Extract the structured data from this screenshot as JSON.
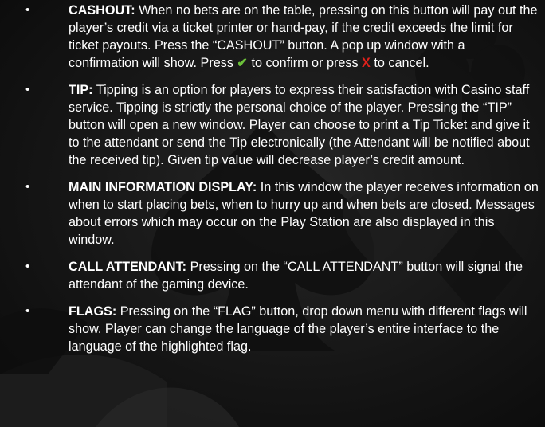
{
  "items": [
    {
      "term": "CASHOUT:",
      "text_before": " When no bets are on the table, pressing on this button will pay out the player’s credit via a ticket printer or hand-pay, if the credit exceeds the limit for ticket payouts. Press the “CASHOUT” button. A pop up window with a confirmation will show. Press ",
      "confirm_symbol": "✔",
      "confirm_icon": "green-check-icon",
      "text_middle": " to confirm or press ",
      "cancel_symbol": "X",
      "cancel_icon": "red-x-icon",
      "text_after": " to cancel."
    },
    {
      "term": "TIP:",
      "text": " Tipping is an option for players to express their satisfaction with Casino staff service. Tipping is strictly the personal choice of the player. Pressing the “TIP” button will open a new window. Player can choose to print a Tip Ticket and give it to the attendant or send the Tip electronically (the Attendant will be notified about the received tip). Given tip value will decrease player’s credit amount."
    },
    {
      "term": "MAIN INFORMATION DISPLAY:",
      "text": " In this window the player receives information on when to start placing bets, when to hurry up and when bets are closed. Messages about errors which may occur on the Play Station are also displayed in this window."
    },
    {
      "term": "CALL ATTENDANT:",
      "text": " Pressing on the “CALL ATTENDANT” button will signal the attendant of the gaming device."
    },
    {
      "term": "FLAGS:",
      "text": " Pressing on the “FLAG” button, drop down menu with different flags will show. Player can change the language of the player’s entire interface to the language of the highlighted flag."
    }
  ],
  "bullet_symbol": "•",
  "colors": {
    "background": "#141414",
    "text": "#ffffff",
    "confirm": "#6cc13a",
    "cancel": "#e0211b"
  }
}
